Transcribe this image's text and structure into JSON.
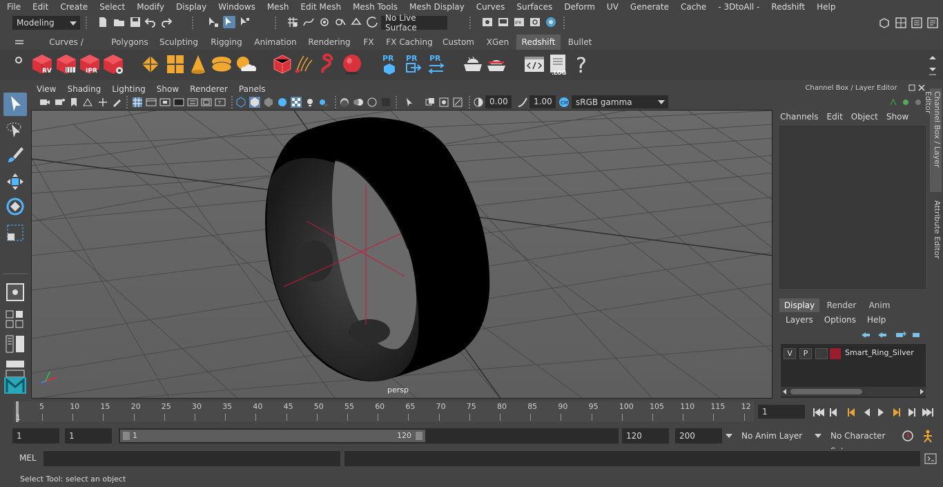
{
  "menubar": [
    "File",
    "Edit",
    "Create",
    "Select",
    "Modify",
    "Display",
    "Windows",
    "Mesh",
    "Edit Mesh",
    "Mesh Tools",
    "Mesh Display",
    "Curves",
    "Surfaces",
    "Deform",
    "UV",
    "Generate",
    "Cache",
    "- 3DtoAll -",
    "Redshift",
    "Help"
  ],
  "statusline": {
    "mode": "Modeling",
    "live_surface": "No Live Surface"
  },
  "shelf": {
    "tabs": [
      "Curves / Surfaces",
      "Polygons",
      "Sculpting",
      "Rigging",
      "Animation",
      "Rendering",
      "FX",
      "FX Caching",
      "Custom",
      "XGen",
      "Redshift",
      "Bullet"
    ],
    "active_tab": "Redshift",
    "icon_labels": {
      "rv": "RV",
      "ipr": "IPR",
      "pr": "PR",
      "log": ".LOG",
      "help": "?"
    }
  },
  "viewport": {
    "menu": [
      "View",
      "Shading",
      "Lighting",
      "Show",
      "Renderer",
      "Panels"
    ],
    "exposure": "0.00",
    "gamma": "1.00",
    "color_space": "sRGB gamma",
    "camera_label": "persp"
  },
  "channel_box": {
    "title": "Channel Box / Layer Editor",
    "menu": [
      "Channels",
      "Edit",
      "Object",
      "Show"
    ],
    "tabs": [
      "Display",
      "Render",
      "Anim"
    ],
    "active_tab": "Display",
    "layer_menu": [
      "Layers",
      "Options",
      "Help"
    ],
    "layers": [
      {
        "v": "V",
        "p": "P",
        "name": "Smart_Ring_Silver",
        "color": "#9b1b30"
      }
    ]
  },
  "side_tabs": [
    "Channel Box / Layer Editor",
    "Attribute Editor"
  ],
  "timeline": {
    "ticks": [
      "5",
      "10",
      "15",
      "20",
      "25",
      "30",
      "35",
      "40",
      "45",
      "50",
      "55",
      "60",
      "65",
      "70",
      "75",
      "80",
      "85",
      "90",
      "95",
      "100",
      "105",
      "110",
      "115",
      "12"
    ],
    "start_marker": "1",
    "current_frame": "1"
  },
  "range": {
    "start": "1",
    "playback_start": "1",
    "slider_start": "1",
    "slider_end": "120",
    "playback_end": "120",
    "end": "200",
    "anim_layer": "No Anim Layer",
    "character_set": "No Character Set"
  },
  "command_line": {
    "label": "MEL"
  },
  "help_line": "Select Tool: select an object"
}
